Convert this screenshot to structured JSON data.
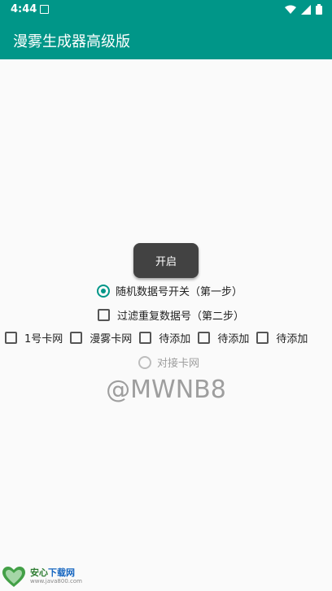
{
  "status": {
    "time": "4:44"
  },
  "appbar": {
    "title": "漫雾生成器高级版"
  },
  "main": {
    "start_button": "开启",
    "radio_random": "随机数据号开关（第一步）",
    "check_filter": "过滤重复数据号（第二步）",
    "checkboxes": [
      "1号卡网",
      "漫雾卡网",
      "待添加",
      "待添加",
      "待添加"
    ],
    "radio_connect": "对接卡网",
    "watermark": "@MWNB8"
  },
  "footer": {
    "brand_green": "安心",
    "brand_blue": "下载网",
    "site": "www.java800.com"
  },
  "colors": {
    "accent": "#009688",
    "button": "#424242"
  }
}
